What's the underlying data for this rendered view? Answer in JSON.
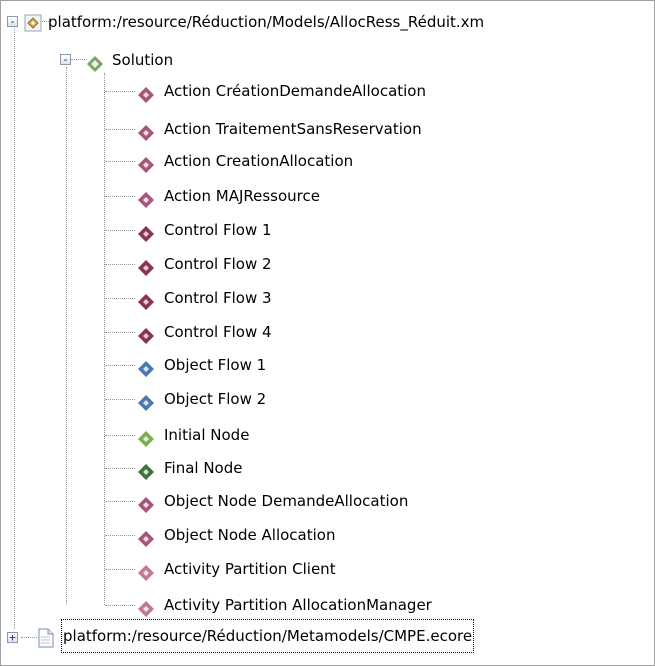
{
  "tree": {
    "root1": {
      "label": "platform:/resource/Réduction/Models/AllocRess_Réduit.xm",
      "expander": "-"
    },
    "solution": {
      "label": "Solution",
      "expander": "-"
    },
    "children": [
      {
        "label": "Action CréationDemandeAllocation",
        "color": "#a8557a"
      },
      {
        "label": "Action TraitementSansReservation",
        "color": "#a8557a"
      },
      {
        "label": "Action CreationAllocation",
        "color": "#a8557a"
      },
      {
        "label": "Action MAJRessource",
        "color": "#a8557a"
      },
      {
        "label": "Control Flow 1",
        "color": "#8a3550"
      },
      {
        "label": "Control Flow 2",
        "color": "#8a3550"
      },
      {
        "label": "Control Flow 3",
        "color": "#8a3550"
      },
      {
        "label": "Control Flow 4",
        "color": "#8a3550"
      },
      {
        "label": "Object Flow 1",
        "color": "#4a78b0"
      },
      {
        "label": "Object Flow 2",
        "color": "#4a78b0"
      },
      {
        "label": "Initial Node",
        "color": "#7ab050"
      },
      {
        "label": "Final Node",
        "color": "#3f7040"
      },
      {
        "label": "Object Node DemandeAllocation",
        "color": "#a8557a"
      },
      {
        "label": "Object Node Allocation",
        "color": "#a8557a"
      },
      {
        "label": "Activity Partition Client",
        "color": "#c07a90"
      },
      {
        "label": "Activity Partition AllocationManager",
        "color": "#c07a90"
      }
    ],
    "root2": {
      "label": "platform:/resource/Réduction/Metamodels/CMPE.ecore",
      "expander": "+"
    }
  },
  "icons": {
    "root1": "model-resource-icon",
    "solution": "solution-diamond-icon",
    "child": "diamond-element-icon",
    "root2": "ecore-file-icon"
  },
  "colors": {
    "solution_diamond": "#7fa060",
    "border": "#a0a0a0",
    "connector": "#9a9a9a"
  }
}
